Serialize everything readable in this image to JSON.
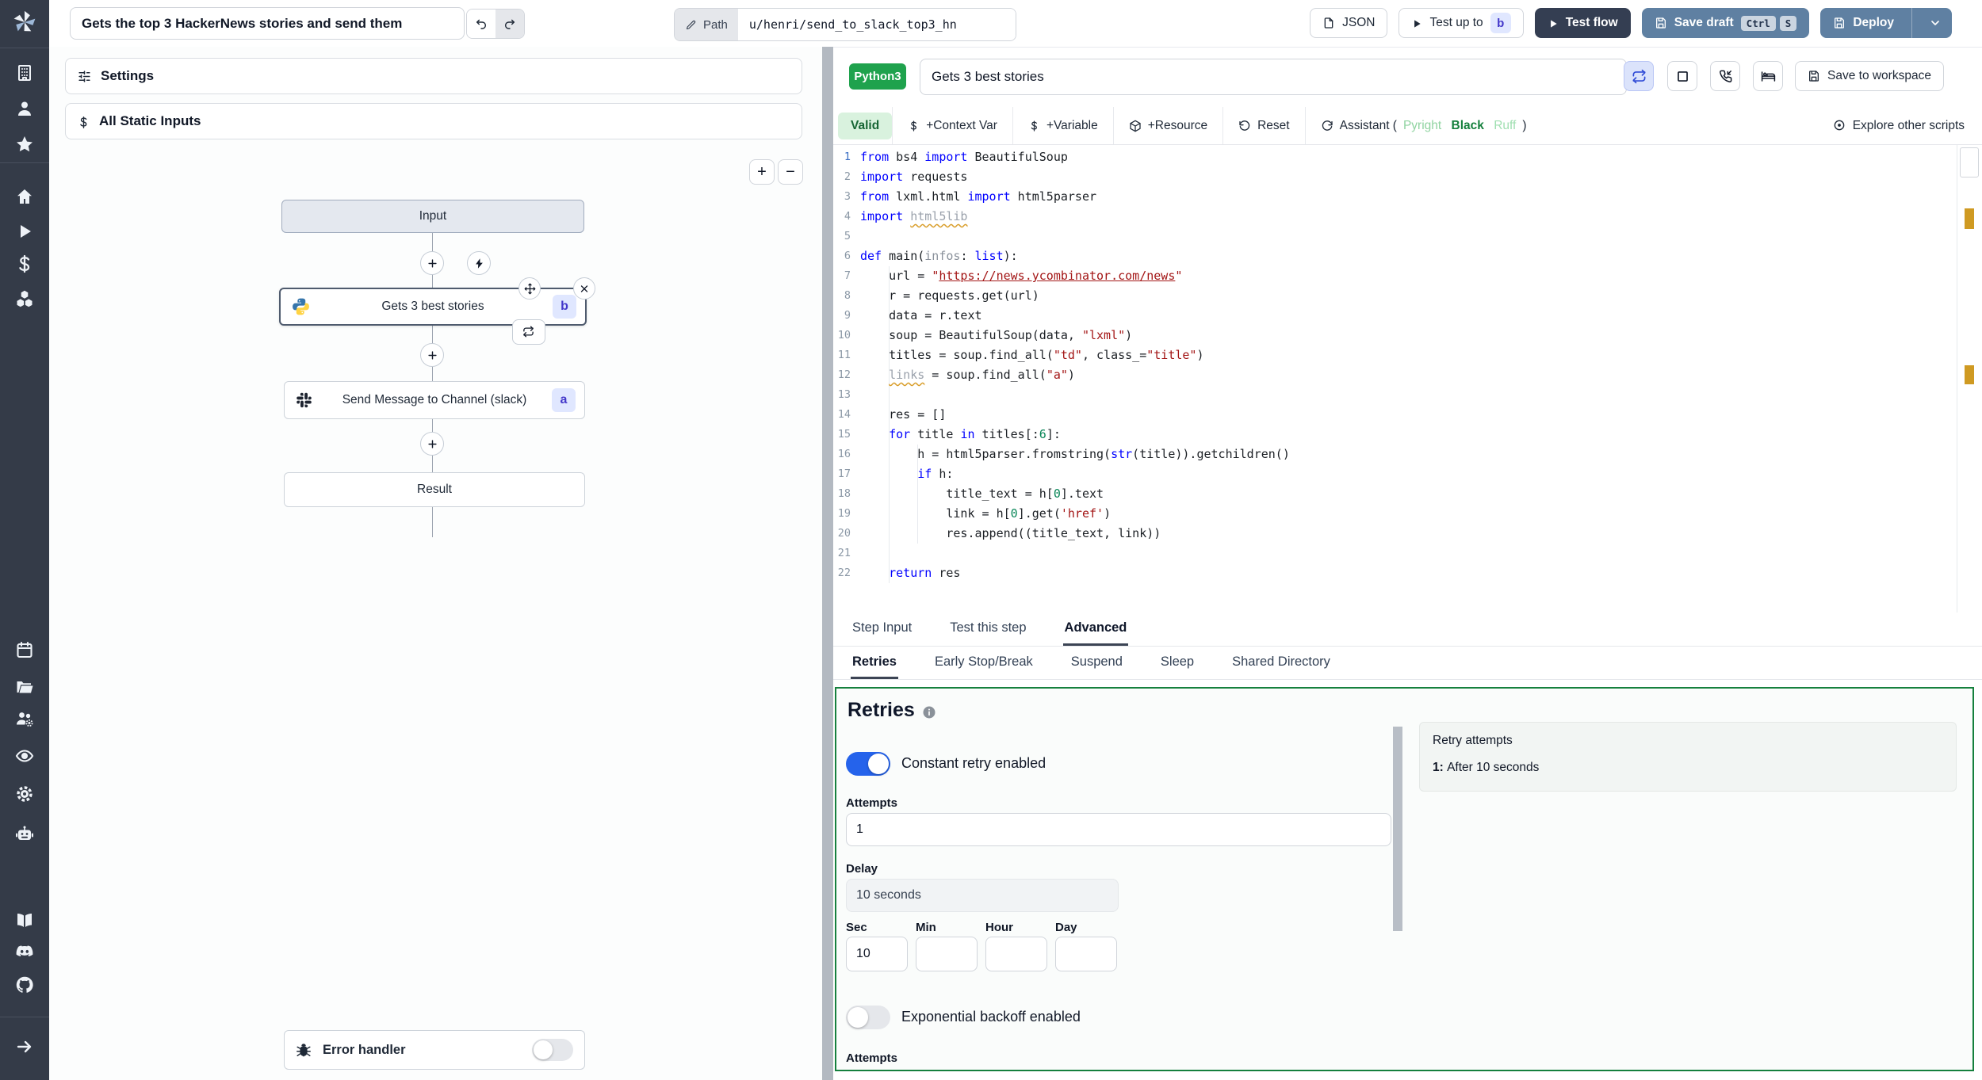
{
  "topbar": {
    "flow_title": "Gets the top 3 HackerNews stories and send them",
    "path_label": "Path",
    "path_value": "u/henri/send_to_slack_top3_hn",
    "json_button": "JSON",
    "test_up_to": "Test up to",
    "test_up_to_badge": "b",
    "test_flow": "Test flow",
    "save_draft": "Save draft",
    "save_draft_keys": [
      "Ctrl",
      "S"
    ],
    "deploy": "Deploy"
  },
  "sidebar": {
    "icons": [
      "building",
      "user",
      "star",
      "home",
      "play",
      "dollar",
      "boxes",
      "calendar",
      "folder-open",
      "users-gear",
      "eye",
      "gear",
      "robot",
      "book-open",
      "discord",
      "github",
      "arrow-right"
    ]
  },
  "flow": {
    "settings_label": "Settings",
    "static_inputs_label": "All Static Inputs",
    "zoom_in_label": "+",
    "zoom_out_label": "−",
    "nodes": {
      "input_label": "Input",
      "step_b_label": "Gets 3 best stories",
      "step_b_badge": "b",
      "step_a_label": "Send Message to Channel (slack)",
      "step_a_badge": "a",
      "result_label": "Result",
      "error_handler_label": "Error handler"
    }
  },
  "editor": {
    "language_badge": "Python3",
    "script_title": "Gets 3 best stories",
    "save_to_workspace": "Save to workspace",
    "toolbar": {
      "valid": "Valid",
      "context_var": "+Context Var",
      "variable": "+Variable",
      "resource": "+Resource",
      "reset": "Reset",
      "assistant": "Assistant",
      "assistant_open": " (",
      "assistant_close": ")",
      "assistant_tools": [
        {
          "label": "Pyright",
          "color": "#8fd3a0",
          "bold": false
        },
        {
          "label": "Black",
          "color": "#15803d",
          "bold": true
        },
        {
          "label": "Ruff",
          "color": "#9fdfb0",
          "bold": false
        }
      ],
      "explore": "Explore other scripts"
    },
    "code": {
      "lines": [
        [
          [
            "kw",
            "from"
          ],
          [
            "pl",
            " bs4 "
          ],
          [
            "kw",
            "import"
          ],
          [
            "pl",
            " BeautifulSoup"
          ]
        ],
        [
          [
            "kw",
            "import"
          ],
          [
            "pl",
            " requests"
          ]
        ],
        [
          [
            "kw",
            "from"
          ],
          [
            "pl",
            " lxml.html "
          ],
          [
            "kw",
            "import"
          ],
          [
            "pl",
            " html5parser"
          ]
        ],
        [
          [
            "kw",
            "import"
          ],
          [
            "pl",
            " "
          ],
          [
            "warn",
            "html5lib"
          ]
        ],
        [],
        [
          [
            "kw",
            "def"
          ],
          [
            "pl",
            " main("
          ],
          [
            "param",
            "infos"
          ],
          [
            "pl",
            ": "
          ],
          [
            "kw",
            "list"
          ],
          [
            "pl",
            "):"
          ]
        ],
        [
          [
            "pl",
            "    url = "
          ],
          [
            "str",
            "\""
          ],
          [
            "stru",
            "https://news.ycombinator.com/news"
          ],
          [
            "str",
            "\""
          ]
        ],
        [
          [
            "pl",
            "    r = requests.get(url)"
          ]
        ],
        [
          [
            "pl",
            "    data = r.text"
          ]
        ],
        [
          [
            "pl",
            "    soup = BeautifulSoup(data, "
          ],
          [
            "str",
            "\"lxml\""
          ],
          [
            "pl",
            ")"
          ]
        ],
        [
          [
            "pl",
            "    titles = soup.find_all("
          ],
          [
            "str",
            "\"td\""
          ],
          [
            "pl",
            ", class_="
          ],
          [
            "str",
            "\"title\""
          ],
          [
            "pl",
            ")"
          ]
        ],
        [
          [
            "pl",
            "    "
          ],
          [
            "warn",
            "links"
          ],
          [
            "pl",
            " = soup.find_all("
          ],
          [
            "str",
            "\"a\""
          ],
          [
            "pl",
            ")"
          ]
        ],
        [],
        [
          [
            "pl",
            "    res = []"
          ]
        ],
        [
          [
            "pl",
            "    "
          ],
          [
            "kw",
            "for"
          ],
          [
            "pl",
            " title "
          ],
          [
            "kw",
            "in"
          ],
          [
            "pl",
            " titles[:"
          ],
          [
            "num",
            "6"
          ],
          [
            "pl",
            "]:"
          ]
        ],
        [
          [
            "pl",
            "        h = html5parser.fromstring("
          ],
          [
            "kw",
            "str"
          ],
          [
            "pl",
            "(title)).getchildren()"
          ]
        ],
        [
          [
            "pl",
            "        "
          ],
          [
            "kw",
            "if"
          ],
          [
            "pl",
            " h:"
          ]
        ],
        [
          [
            "pl",
            "            title_text = h["
          ],
          [
            "num",
            "0"
          ],
          [
            "pl",
            "].text"
          ]
        ],
        [
          [
            "pl",
            "            link = h["
          ],
          [
            "num",
            "0"
          ],
          [
            "pl",
            "].get("
          ],
          [
            "str",
            "'href'"
          ],
          [
            "pl",
            ")"
          ]
        ],
        [
          [
            "pl",
            "            res.append((title_text, link))"
          ]
        ],
        [],
        [
          [
            "pl",
            "    "
          ],
          [
            "kw",
            "return"
          ],
          [
            "pl",
            " res"
          ]
        ]
      ]
    }
  },
  "tabs": {
    "main": [
      "Step Input",
      "Test this step",
      "Advanced"
    ],
    "main_active": "Advanced",
    "sub": [
      "Retries",
      "Early Stop/Break",
      "Suspend",
      "Sleep",
      "Shared Directory"
    ],
    "sub_active": "Retries"
  },
  "retries": {
    "title": "Retries",
    "constant_toggle_label": "Constant retry enabled",
    "constant_enabled": true,
    "attempts_label": "Attempts",
    "attempts_value": "1",
    "delay_label": "Delay",
    "delay_value": "10 seconds",
    "time_fields": [
      {
        "label": "Sec",
        "value": "10"
      },
      {
        "label": "Min",
        "value": ""
      },
      {
        "label": "Hour",
        "value": ""
      },
      {
        "label": "Day",
        "value": ""
      }
    ],
    "exponential_toggle_label": "Exponential backoff enabled",
    "exponential_enabled": false,
    "attempts_label_bottom": "Attempts",
    "summary": {
      "title": "Retry attempts",
      "items": [
        {
          "prefix": "1:",
          "text": "After 10 seconds"
        }
      ]
    }
  },
  "colors": {
    "sidebar_bg": "#343b48",
    "accent_blue": "#2563eb",
    "language_badge_green": "#1fa24d",
    "valid_bg": "#d9f2de",
    "valid_text": "#166534",
    "panel_border_green": "#15803d",
    "warning_marker": "#cf9a22",
    "dark_button": "#343e52",
    "blue_button": "#5f80a2",
    "step_badge_bg": "#e0e7ff",
    "step_badge_text": "#4338ca"
  }
}
